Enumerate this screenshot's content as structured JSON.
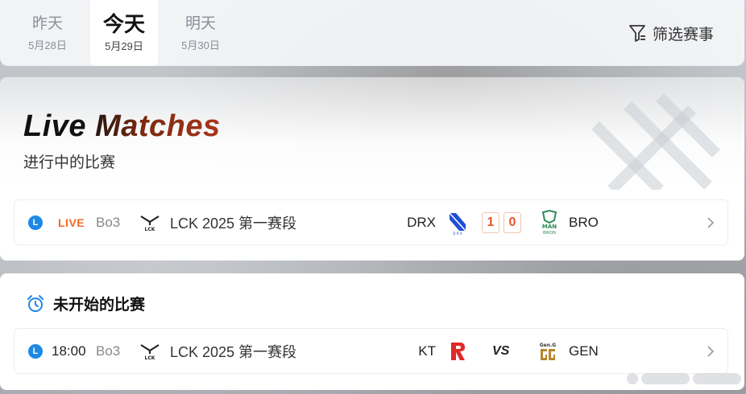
{
  "dates": [
    {
      "day": "昨天",
      "date": "5月28日"
    },
    {
      "day": "今天",
      "date": "5月29日"
    },
    {
      "day": "明天",
      "date": "5月30日"
    }
  ],
  "filter": {
    "label": "筛选赛事",
    "icon": "filter-icon"
  },
  "live": {
    "title": "Live Matches",
    "subtitle": "进行中的比赛",
    "match": {
      "league_badge": "L",
      "status": "LIVE",
      "format": "Bo3",
      "league": "LCK 2025 第一赛段",
      "team1": "DRX",
      "score1": "1",
      "score2": "0",
      "team2": "BRO"
    }
  },
  "upcoming": {
    "title": "未开始的比赛",
    "icon": "alarm-clock-icon",
    "match": {
      "league_badge": "L",
      "time": "18:00",
      "format": "Bo3",
      "league": "LCK 2025 第一赛段",
      "team1": "KT",
      "vs": "VS",
      "team2": "GEN"
    }
  },
  "colors": {
    "accent": "#f26b2a",
    "badge": "#1e88e5"
  }
}
